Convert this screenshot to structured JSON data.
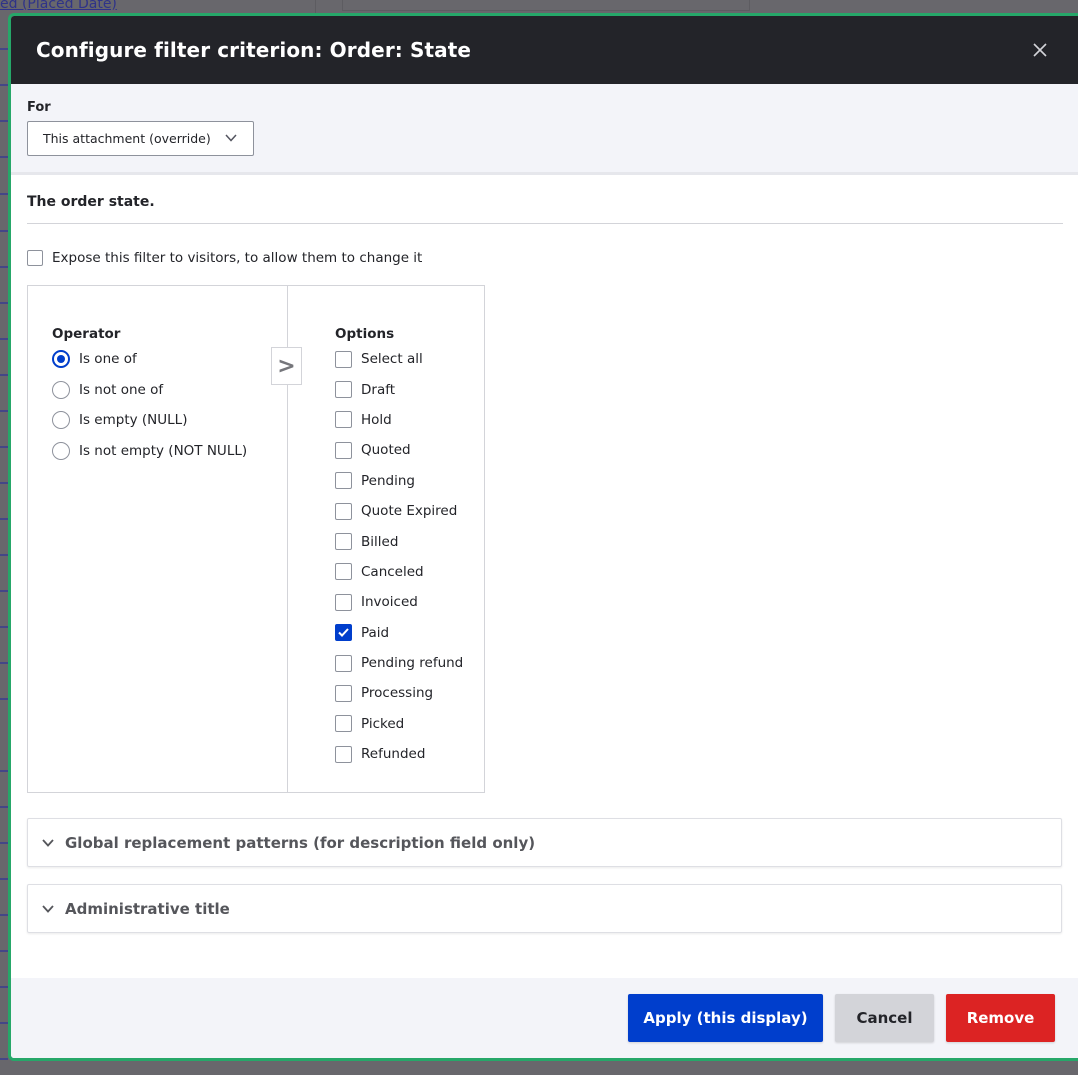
{
  "background": {
    "top_link_text": "ed (Placed Date)"
  },
  "dialog": {
    "title": "Configure filter criterion: Order: State",
    "close_label": "Close",
    "for": {
      "label": "For",
      "selected": "This attachment (override)"
    },
    "description": "The order state.",
    "expose": {
      "label": "Expose this filter to visitors, to allow them to change it",
      "checked": false
    },
    "operator": {
      "title": "Operator",
      "options": [
        {
          "label": "Is one of",
          "checked": true
        },
        {
          "label": "Is not one of",
          "checked": false
        },
        {
          "label": "Is empty (NULL)",
          "checked": false
        },
        {
          "label": "Is not empty (NOT NULL)",
          "checked": false
        }
      ]
    },
    "arrow_label": ">",
    "options": {
      "title": "Options",
      "items": [
        {
          "label": "Select all",
          "checked": false
        },
        {
          "label": "Draft",
          "checked": false
        },
        {
          "label": "Hold",
          "checked": false
        },
        {
          "label": "Quoted",
          "checked": false
        },
        {
          "label": "Pending",
          "checked": false
        },
        {
          "label": "Quote Expired",
          "checked": false
        },
        {
          "label": "Billed",
          "checked": false
        },
        {
          "label": "Canceled",
          "checked": false
        },
        {
          "label": "Invoiced",
          "checked": false
        },
        {
          "label": "Paid",
          "checked": true
        },
        {
          "label": "Pending refund",
          "checked": false
        },
        {
          "label": "Processing",
          "checked": false
        },
        {
          "label": "Picked",
          "checked": false
        },
        {
          "label": "Refunded",
          "checked": false
        }
      ]
    },
    "sections": [
      {
        "label": "Global replacement patterns (for description field only)"
      },
      {
        "label": "Administrative title"
      }
    ],
    "buttons": {
      "apply": "Apply (this display)",
      "cancel": "Cancel",
      "remove": "Remove"
    },
    "colors": {
      "accent": "#003ecc",
      "danger": "#dc2323",
      "header": "#232429",
      "focus_border": "#26a769"
    }
  }
}
